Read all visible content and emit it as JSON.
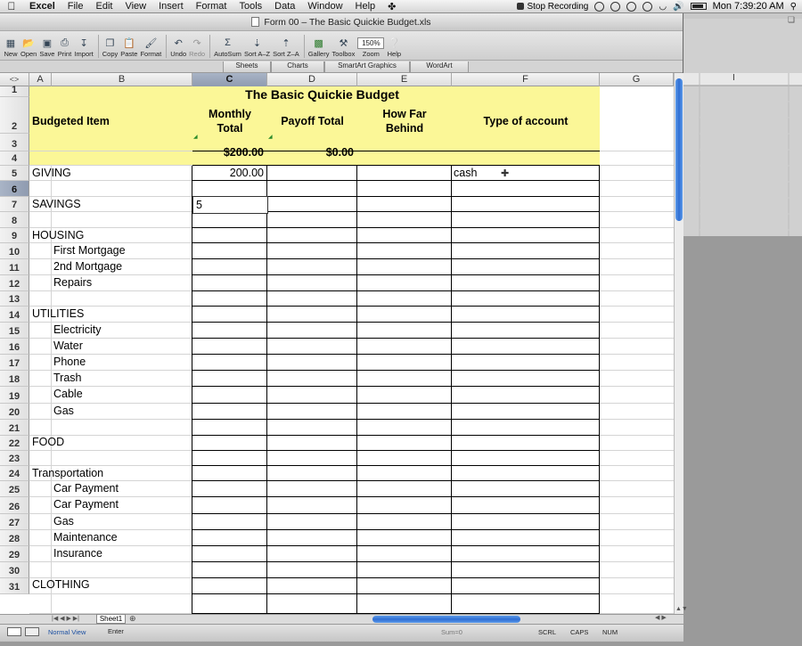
{
  "menubar": {
    "app": "Excel",
    "items": [
      "File",
      "Edit",
      "View",
      "Insert",
      "Format",
      "Tools",
      "Data",
      "Window",
      "Help"
    ],
    "recording": "Stop Recording",
    "clock": "Mon 7:39:20 AM"
  },
  "window": {
    "title": "Form 00 – The Basic Quickie Budget.xls"
  },
  "toolbar": {
    "new": "New",
    "open": "Open",
    "save": "Save",
    "print": "Print",
    "import": "Import",
    "copy": "Copy",
    "paste": "Paste",
    "format": "Format",
    "undo": "Undo",
    "redo": "Redo",
    "autosum": "AutoSum",
    "sort_az": "Sort A–Z",
    "sort_za": "Sort Z–A",
    "gallery": "Gallery",
    "toolbox": "Toolbox",
    "zoom_value": "150%",
    "zoom": "Zoom",
    "help": "Help"
  },
  "ribbon": {
    "tabs": [
      "Sheets",
      "Charts",
      "SmartArt Graphics",
      "WordArt"
    ]
  },
  "columns": [
    "A",
    "B",
    "C",
    "D",
    "E",
    "F",
    "G",
    "I"
  ],
  "rows": [
    "1",
    "2",
    "3",
    "4",
    "5",
    "6",
    "7",
    "8",
    "9",
    "10",
    "11",
    "12",
    "13",
    "14",
    "15",
    "16",
    "17",
    "18",
    "19",
    "20",
    "21",
    "22",
    "23",
    "24",
    "25",
    "26",
    "27",
    "28",
    "29",
    "30",
    "31"
  ],
  "budget": {
    "title": "The Basic Quickie Budget",
    "headers": {
      "item": "Budgeted Item",
      "monthly_1": "Monthly",
      "monthly_2": "Total",
      "payoff": "Payoff Total",
      "behind_1": "How Far",
      "behind_2": "Behind",
      "type": "Type of account"
    },
    "totals": {
      "monthly": "$200.00",
      "payoff": "$0.00"
    },
    "items": {
      "r4": "GIVING",
      "r6": "SAVINGS",
      "r8": "HOUSING",
      "r9": "First Mortgage",
      "r10": "2nd Mortgage",
      "r11": "Repairs",
      "r13": "UTILITIES",
      "r14": "Electricity",
      "r15": "Water",
      "r16": "Phone",
      "r17": "Trash",
      "r18": "Cable",
      "r19": "Gas",
      "r21": "FOOD",
      "r23": "Transportation",
      "r24": "Car Payment",
      "r25": "Car Payment",
      "r26": "Gas",
      "r27": "Maintenance",
      "r28": "Insurance",
      "r30": "CLOTHING"
    },
    "giving_monthly": "200.00",
    "giving_type": "cash",
    "active_cell_entry": "5"
  },
  "sheet_tabs": [
    "Sheet1"
  ],
  "status": {
    "view": "Normal View",
    "mode": "Enter",
    "sum": "Sum=0",
    "scrl": "SCRL",
    "caps": "CAPS",
    "num": "NUM"
  }
}
